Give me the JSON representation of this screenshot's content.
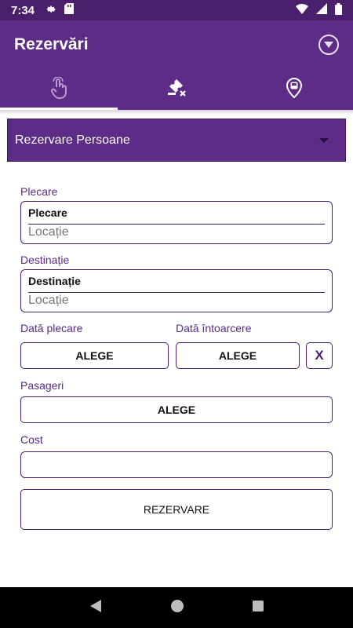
{
  "status_bar": {
    "time": "7:34",
    "icons": [
      "gear-icon",
      "sd-card-icon",
      "wifi-icon",
      "signal-icon",
      "battery-icon"
    ]
  },
  "app_bar": {
    "title": "Rezervări",
    "menu_icon": "chevron-down-circle-icon"
  },
  "tabs": [
    {
      "icon": "touch-icon",
      "active": true
    },
    {
      "icon": "ticket-cancel-icon",
      "active": false
    },
    {
      "icon": "bus-location-icon",
      "active": false
    }
  ],
  "spinner": {
    "selected": "Rezervare Persoane"
  },
  "form": {
    "departure_label": "Plecare",
    "departure_field_title": "Plecare",
    "departure_placeholder": "Locație",
    "destination_label": "Destinație",
    "destination_field_title": "Destinație",
    "destination_placeholder": "Locație",
    "departure_date_label": "Dată plecare",
    "return_date_label": "Dată întoarcere",
    "departure_date_button": "ALEGE",
    "return_date_button": "ALEGE",
    "clear_button": "X",
    "passengers_label": "Pasageri",
    "passengers_button": "ALEGE",
    "cost_label": "Cost",
    "cost_value": "",
    "submit_button": "REZERVARE"
  },
  "colors": {
    "primary": "#5c2c86",
    "primary_dark": "#4a1f6b",
    "accent_text": "#5a2a86"
  }
}
